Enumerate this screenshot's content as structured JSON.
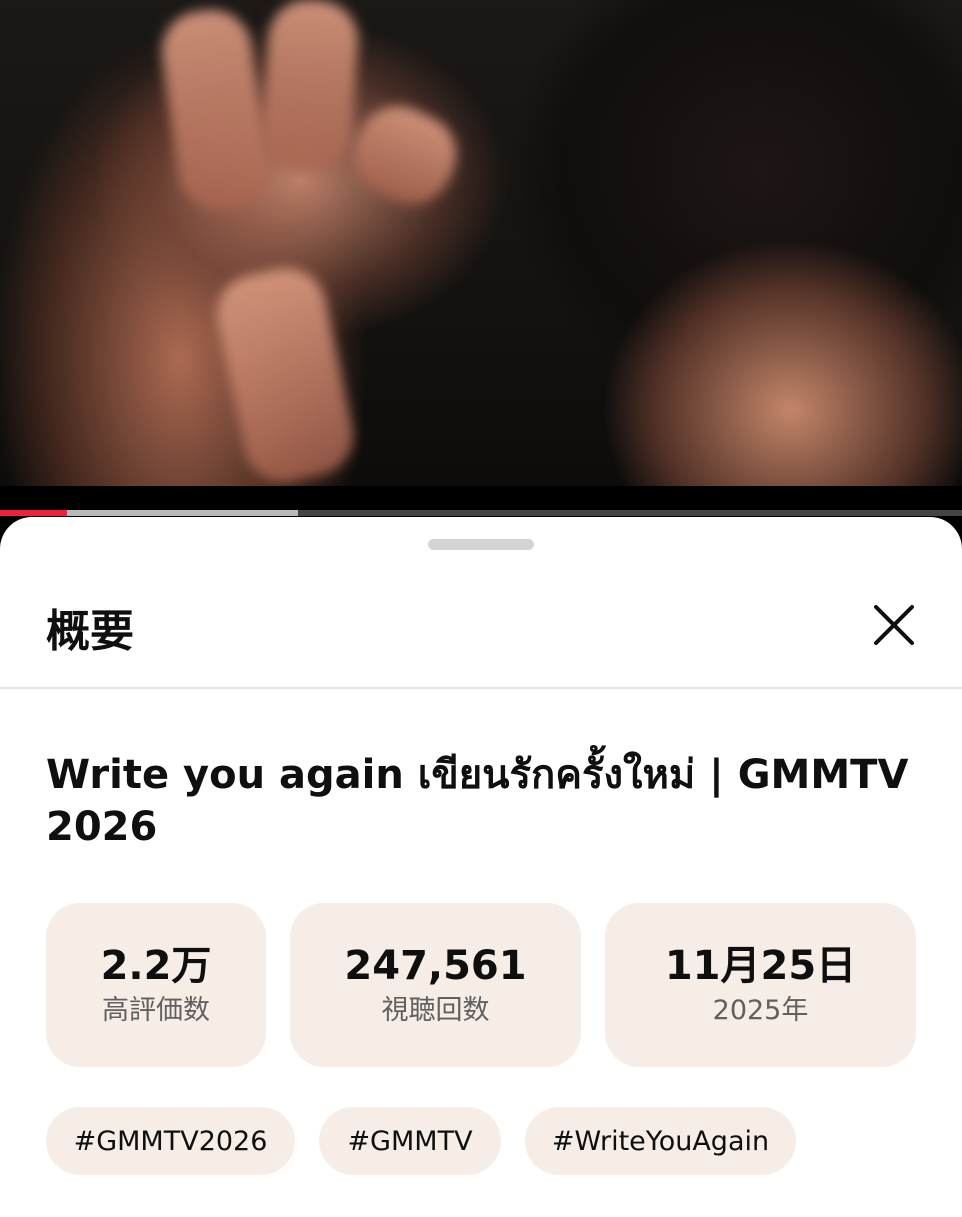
{
  "player": {
    "progress_played": 0.07,
    "progress_buffered": 0.31
  },
  "sheet": {
    "title": "概要",
    "close_icon": "close-icon"
  },
  "video": {
    "title": "Write you again เขียนรักครั้งใหม่ | GMMTV 2026"
  },
  "stats": [
    {
      "value": "2.2万",
      "label": "高評価数"
    },
    {
      "value": "247,561",
      "label": "視聴回数"
    },
    {
      "value": "11月25日",
      "label": "2025年"
    }
  ],
  "hashtags": [
    "#GMMTV2026",
    "#GMMTV",
    "#WriteYouAgain"
  ],
  "colors": {
    "progress_played": "#f0213f",
    "chip_background": "#f6ede7"
  }
}
